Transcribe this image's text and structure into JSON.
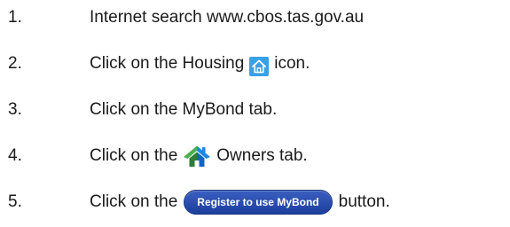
{
  "steps": [
    {
      "number": "1.",
      "before": "Internet search www.cbos.tas.gov.au"
    },
    {
      "number": "2.",
      "before": "Click on the Housing",
      "icon": "house-icon",
      "after": "icon."
    },
    {
      "number": "3.",
      "before": "Click on the MyBond tab."
    },
    {
      "number": "4.",
      "before": "Click on the",
      "icon": "house-roof-icon",
      "after": "Owners tab."
    },
    {
      "number": "5.",
      "before": "Click on the",
      "button_label": "Register to use MyBond",
      "after": "button."
    }
  ],
  "colors": {
    "housing_icon_bg": "#3aa0e6",
    "owners_icon_green": "#4caf50",
    "owners_icon_blue": "#1e88e5",
    "button_bg": "#1c3f9e"
  }
}
